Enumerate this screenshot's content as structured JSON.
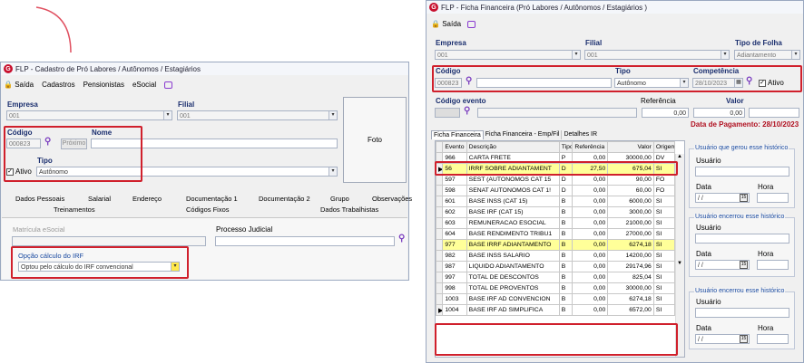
{
  "left": {
    "title": "FLP - Cadastro de Pró Labores / Autônomos / Estagiários",
    "toolbar": {
      "saida": "Saída",
      "cadastros": "Cadastros",
      "pensionistas": "Pensionistas",
      "esocial": "eSocial"
    },
    "empresa_label": "Empresa",
    "empresa_value": "001",
    "filial_label": "Filial",
    "filial_value": "001",
    "foto": "Foto",
    "codigo_label": "Código",
    "codigo_value": "000823",
    "proximo": "Próximo",
    "nome_label": "Nome",
    "ativo_label": "Ativo",
    "tipo_label": "Tipo",
    "tipo_value": "Autônomo",
    "tabs_row1": [
      "Dados Pessoais",
      "Salarial",
      "Endereço",
      "Documentação 1",
      "Documentação 2",
      "Grupo",
      "Observações"
    ],
    "tabs_row2": [
      "Treinamentos",
      "Códigos Fixos",
      "Dados Trabalhistas"
    ],
    "matricula_label": "Matrícula eSocial",
    "processo_label": "Processo Judicial",
    "irrf_label": "Opção cálculo do IRF",
    "irrf_value": "Optou pelo cálculo do IRF convencional"
  },
  "right": {
    "title": "FLP - Ficha Financeira (Pró Labores / Autônomos / Estagiários )",
    "saida": "Saída",
    "empresa_label": "Empresa",
    "empresa_value": "001",
    "filial_label": "Filial",
    "filial_value": "001",
    "tipo_folha_label": "Tipo de Folha",
    "tipo_folha_value": "Adiantamento",
    "codigo_label": "Código",
    "codigo_value": "000823",
    "tipo_label": "Tipo",
    "tipo_value": "Autônomo",
    "competencia_label": "Competência",
    "competencia_value": "28/10/2023",
    "ativo_label": "Ativo",
    "codigo_evento_label": "Código evento",
    "referencia_label": "Referência",
    "referencia_value": "0,00",
    "valor_label": "Valor",
    "valor_value": "0,00",
    "data_pagamento": "Data de Pagamento: 28/10/2023",
    "tabs": [
      "Ficha Financeira",
      "Ficha Financeira - Emp/Fil",
      "Detalhes IR"
    ],
    "columns": [
      "Evento",
      "Descrição",
      "Tipo",
      "Referência",
      "Valor",
      "Origem"
    ],
    "rows": [
      [
        "966",
        "CARTA FRETE",
        "P",
        "0,00",
        "30000,00",
        "DV"
      ],
      [
        "56",
        "IRRF SOBRE ADIANTAMENT",
        "D",
        "27,50",
        "675,04",
        "SI"
      ],
      [
        "597",
        "SEST (AUTONOMOS CAT 15",
        "D",
        "0,00",
        "90,00",
        "FO"
      ],
      [
        "598",
        "SENAT AUTONOMOS CAT 1!",
        "D",
        "0,00",
        "60,00",
        "FO"
      ],
      [
        "601",
        "BASE INSS (CAT 15)",
        "B",
        "0,00",
        "6000,00",
        "SI"
      ],
      [
        "602",
        "BASE IRF (CAT 15)",
        "B",
        "0,00",
        "3000,00",
        "SI"
      ],
      [
        "603",
        "REMUNERACAO ESOCIAL",
        "B",
        "0,00",
        "21000,00",
        "SI"
      ],
      [
        "604",
        "BASE RENDIMENTO TRIBU1",
        "B",
        "0,00",
        "27000,00",
        "SI"
      ],
      [
        "977",
        "BASE IRRF ADIANTAMENTO",
        "B",
        "0,00",
        "6274,18",
        "SI"
      ],
      [
        "982",
        "BASE INSS SALARIO",
        "B",
        "0,00",
        "14200,00",
        "SI"
      ],
      [
        "987",
        "LIQUIDO ADIANTAMENTO",
        "B",
        "0,00",
        "29174,96",
        "SI"
      ],
      [
        "997",
        "TOTAL DE DESCONTOS",
        "B",
        "0,00",
        "825,04",
        "SI"
      ],
      [
        "998",
        "TOTAL DE PROVENTOS",
        "B",
        "0,00",
        "30000,00",
        "SI"
      ],
      [
        "1003",
        "BASE IRF AD CONVENCION",
        "B",
        "0,00",
        "6274,18",
        "SI"
      ],
      [
        "1004",
        "BASE IRF AD SIMPLIFICA",
        "B",
        "0,00",
        "6572,00",
        "SI"
      ]
    ],
    "hist1_title": "Usuário que gerou esse histórico",
    "hist2_title": "Usuário encerrou esse histórico",
    "hist3_title": "Usuário encerrou esse histórico",
    "usuario_label": "Usuário",
    "data_label": "Data",
    "hora_label": "Hora",
    "date_placeholder": " / /"
  }
}
